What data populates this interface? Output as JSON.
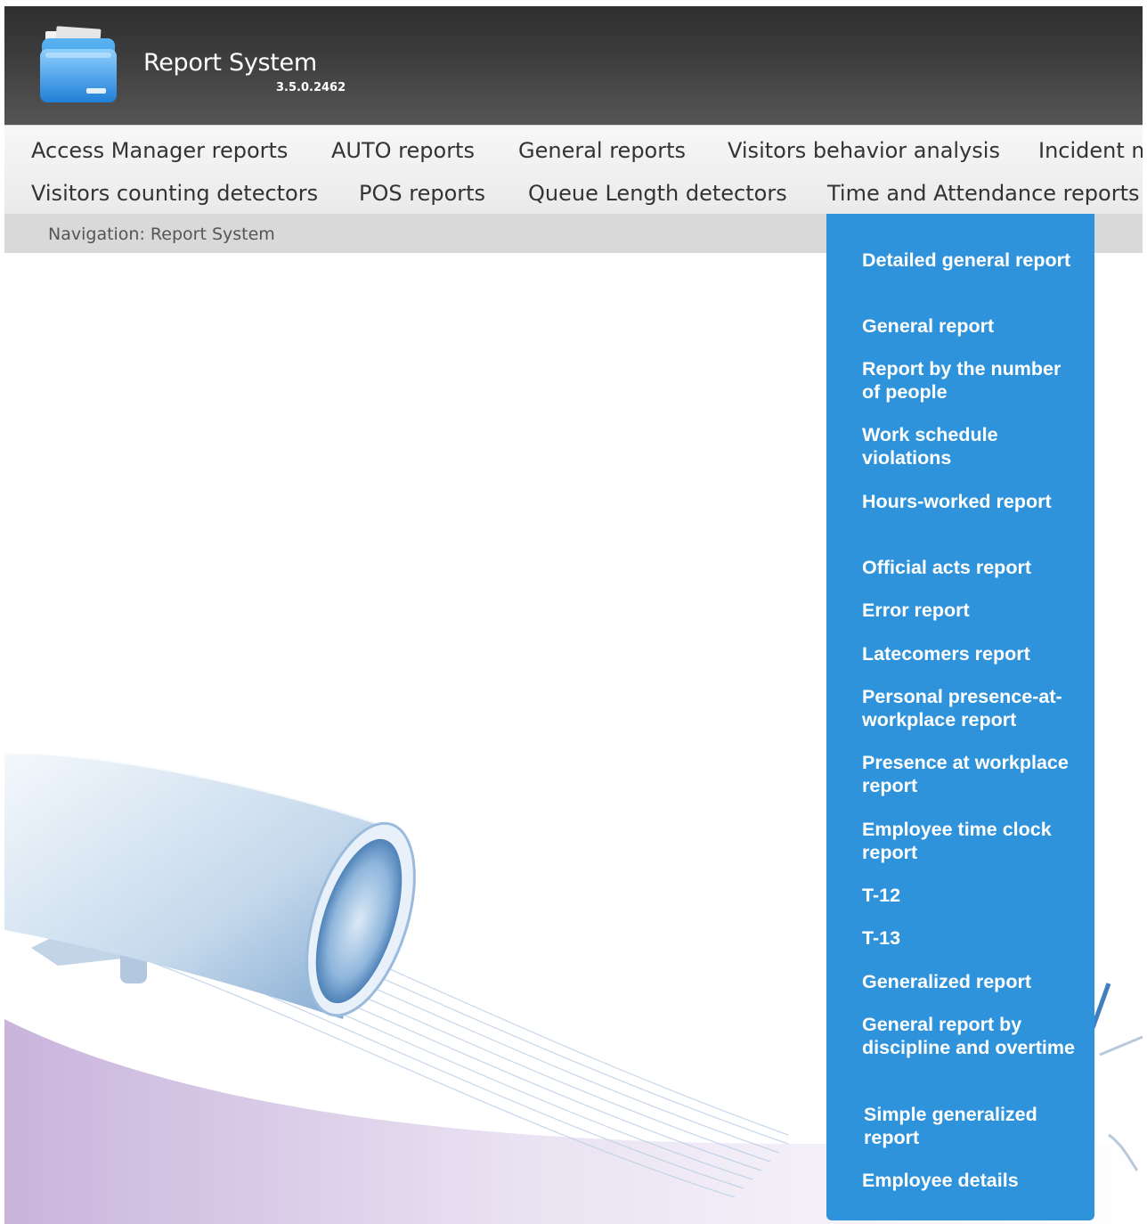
{
  "header": {
    "title": "Report System",
    "version": "3.5.0.2462",
    "logo_icon": "folder-icon"
  },
  "menu": {
    "row1": [
      "Access Manager reports",
      "AUTO reports",
      "General reports",
      "Visitors behavior analysis",
      "Incident m"
    ],
    "row2": [
      "Visitors counting detectors",
      "POS reports",
      "Queue Length detectors",
      "Time and Attendance reports"
    ]
  },
  "breadcrumb": {
    "text": "Navigation: Report System"
  },
  "dropdown": {
    "accent": "#2f93db",
    "items": [
      "Detailed general report",
      "General report",
      "Report by the number of people",
      "Work schedule violations",
      "Hours-worked report",
      "Official acts report",
      "Error report",
      "Latecomers report",
      "Personal presence-at-workplace report",
      "Presence at workplace report",
      "Employee time clock report",
      "T-12",
      "T-13",
      "Generalized report",
      "General report by discipline and overtime",
      "Simple generalized report",
      "Employee details"
    ]
  }
}
